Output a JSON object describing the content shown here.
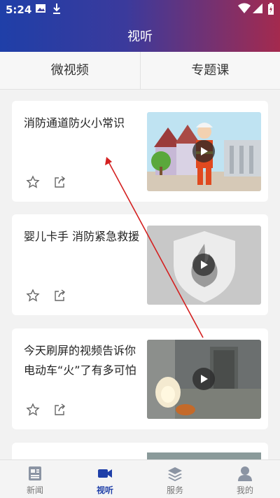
{
  "status": {
    "time": "5:24"
  },
  "header": {
    "title": "视听"
  },
  "tabs": [
    {
      "label": "微视频"
    },
    {
      "label": "专题课"
    }
  ],
  "videos": [
    {
      "title": "消防通道防火小常识",
      "thumbnail": "cartoon-firefighter-street"
    },
    {
      "title": "婴儿卡手 消防紧急救援",
      "thumbnail": "fire-shield-logo"
    },
    {
      "title": "今天刷屏的视频告诉你电动车“火”了有多可怕",
      "thumbnail": "cctv-elevator-fire"
    }
  ],
  "bottom_nav": [
    {
      "label": "新闻",
      "icon": "news-icon"
    },
    {
      "label": "视听",
      "icon": "video-camera-icon",
      "active": true
    },
    {
      "label": "服务",
      "icon": "layers-icon"
    },
    {
      "label": "我的",
      "icon": "person-icon"
    }
  ],
  "colors": {
    "accent": "#1f3fa8",
    "header_end": "#a42a4e",
    "annotation": "#d42020"
  }
}
